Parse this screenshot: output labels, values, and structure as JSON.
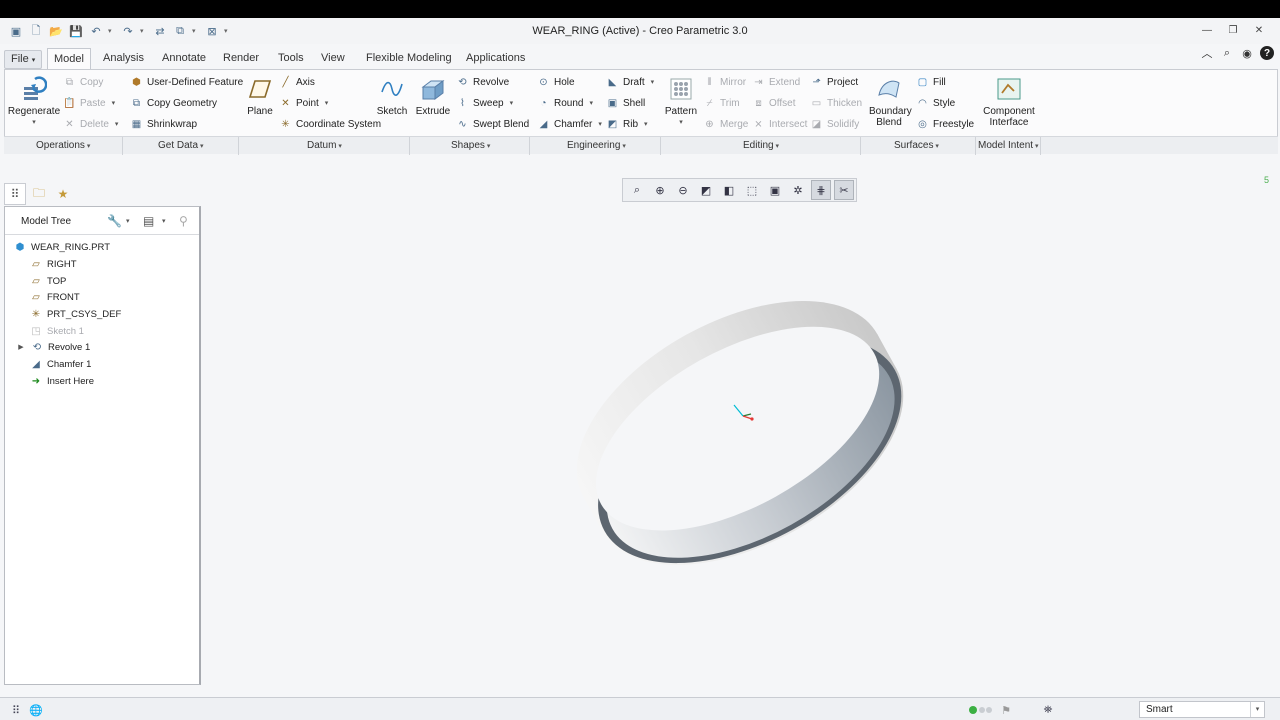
{
  "window": {
    "title": "WEAR_RING (Active) - Creo Parametric 3.0"
  },
  "tabs": [
    {
      "label": "File"
    },
    {
      "label": "Model"
    },
    {
      "label": "Analysis"
    },
    {
      "label": "Annotate"
    },
    {
      "label": "Render"
    },
    {
      "label": "Tools"
    },
    {
      "label": "View"
    },
    {
      "label": "Flexible Modeling"
    },
    {
      "label": "Applications"
    }
  ],
  "ribbon": {
    "operations": {
      "label": "Operations",
      "regenerate": "Regenerate",
      "copy": "Copy",
      "paste": "Paste",
      "delete": "Delete"
    },
    "get_data": {
      "label": "Get Data",
      "udf": "User-Defined Feature",
      "copy_geometry": "Copy Geometry",
      "shrinkwrap": "Shrinkwrap"
    },
    "datum": {
      "label": "Datum",
      "plane": "Plane",
      "axis": "Axis",
      "point": "Point",
      "csys": "Coordinate System",
      "sketch": "Sketch"
    },
    "shapes": {
      "label": "Shapes",
      "extrude": "Extrude",
      "revolve": "Revolve",
      "sweep": "Sweep",
      "swept_blend": "Swept Blend"
    },
    "engineering": {
      "label": "Engineering",
      "hole": "Hole",
      "round": "Round",
      "chamfer": "Chamfer",
      "draft": "Draft",
      "shell": "Shell",
      "rib": "Rib"
    },
    "editing": {
      "label": "Editing",
      "pattern": "Pattern",
      "mirror": "Mirror",
      "trim": "Trim",
      "merge": "Merge",
      "extend": "Extend",
      "offset": "Offset",
      "intersect": "Intersect",
      "project": "Project",
      "thicken": "Thicken",
      "solidify": "Solidify"
    },
    "surfaces": {
      "label": "Surfaces",
      "boundary_blend": "Boundary Blend",
      "fill": "Fill",
      "style": "Style",
      "freestyle": "Freestyle"
    },
    "model_intent": {
      "label": "Model Intent",
      "component_interface": "Component Interface"
    }
  },
  "model_tree": {
    "title": "Model Tree",
    "items": [
      {
        "label": "WEAR_RING.PRT"
      },
      {
        "label": "RIGHT"
      },
      {
        "label": "TOP"
      },
      {
        "label": "FRONT"
      },
      {
        "label": "PRT_CSYS_DEF"
      },
      {
        "label": "Sketch 1"
      },
      {
        "label": "Revolve 1"
      },
      {
        "label": "Chamfer 1"
      },
      {
        "label": "Insert Here"
      }
    ]
  },
  "viewport": {
    "counter": "5"
  },
  "status": {
    "filter": "Smart"
  },
  "colors": {
    "accent": "#2f7fc1",
    "ring_dark": "#5d6670",
    "ring_light": "#f1f1f1",
    "status_green": "#3cb043"
  }
}
